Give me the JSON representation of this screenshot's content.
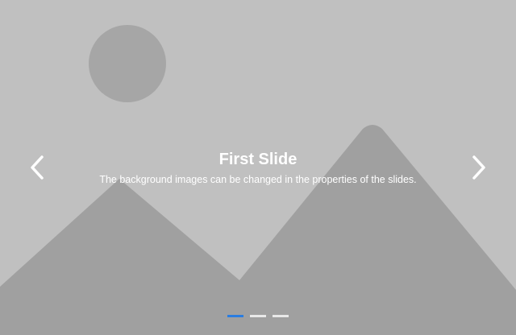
{
  "carousel": {
    "slides": [
      {
        "title": "First Slide",
        "text": "The background images can be changed in the properties of the slides.",
        "active": true
      }
    ],
    "indicator_count": 3,
    "active_index": 0,
    "icons": {
      "prev": "chevron-left-icon",
      "next": "chevron-right-icon",
      "background": "image-placeholder-icon"
    },
    "colors": {
      "background": "#c0c0c0",
      "sun": "#a6a6a6",
      "mountains": "#a0a0a0",
      "caption_text": "#ffffff",
      "indicator_active": "#2a7de1",
      "indicator_inactive": "#e8e8e8"
    }
  }
}
